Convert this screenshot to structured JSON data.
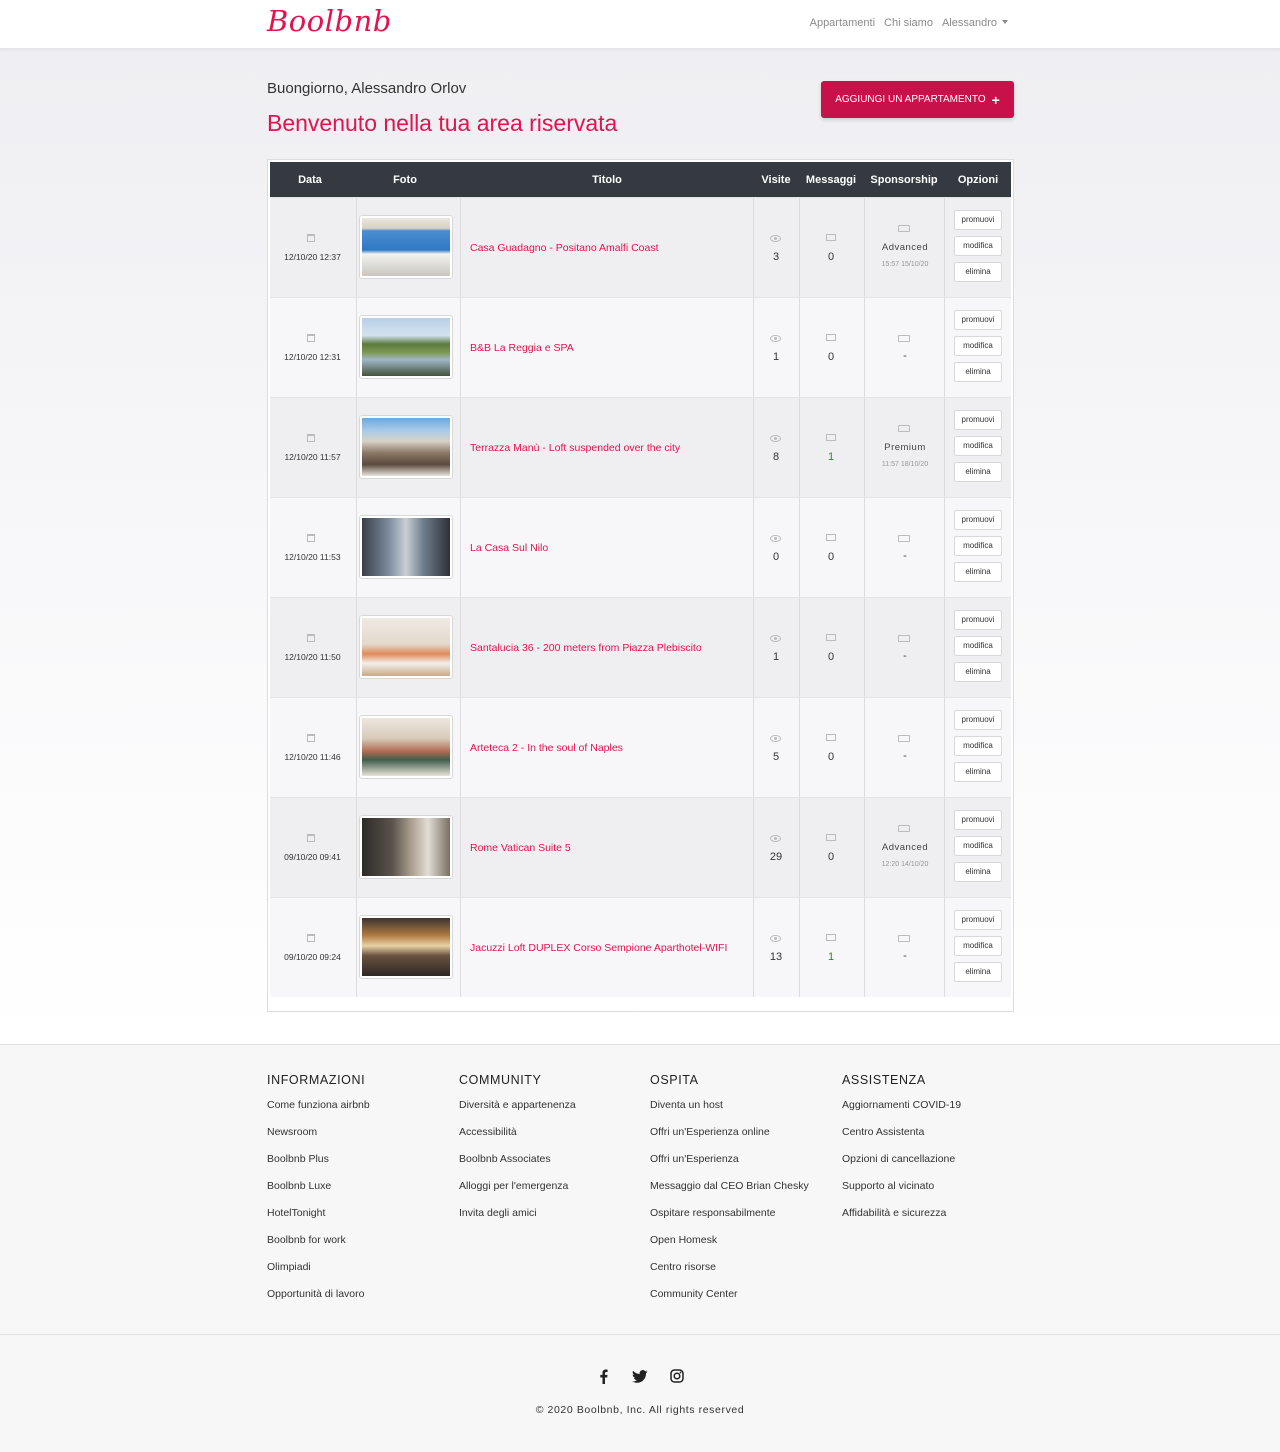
{
  "brand": "Boolbnb",
  "nav": {
    "apartments": "Appartamenti",
    "about": "Chi siamo",
    "user": "Alessandro"
  },
  "header": {
    "greeting": "Buongiorno, Alessandro Orlov",
    "welcome": "Benvenuto nella tua area riservata",
    "add_button": "AGGIUNGI UN APPARTAMENTO",
    "accent_color": "#e0144e"
  },
  "table": {
    "headers": {
      "date": "Data",
      "photo": "Foto",
      "title": "Titolo",
      "visits": "Visite",
      "messages": "Messaggi",
      "sponsorship": "Sponsorship",
      "options": "Opzioni"
    },
    "options": {
      "promote": "promuovi",
      "edit": "modifica",
      "delete": "elimina"
    },
    "rows": [
      {
        "date": "12/10/20 12:37",
        "title": "Casa Guadagno - Positano Amalfi Coast",
        "visits": "3",
        "messages": "0",
        "sponsor": "Advanced",
        "sponsor_time": "15:57 15/10/20"
      },
      {
        "date": "12/10/20 12:31",
        "title": "B&B La Reggia e SPA",
        "visits": "1",
        "messages": "0",
        "sponsor": "-",
        "sponsor_time": ""
      },
      {
        "date": "12/10/20 11:57",
        "title": "Terrazza Manù - Loft suspended over the city",
        "visits": "8",
        "messages": "1",
        "sponsor": "Premium",
        "sponsor_time": "11:57 18/10/20"
      },
      {
        "date": "12/10/20 11:53",
        "title": "La Casa Sul Nilo",
        "visits": "0",
        "messages": "0",
        "sponsor": "-",
        "sponsor_time": ""
      },
      {
        "date": "12/10/20 11:50",
        "title": "Santalucia 36 - 200 meters from Piazza Plebiscito",
        "visits": "1",
        "messages": "0",
        "sponsor": "-",
        "sponsor_time": ""
      },
      {
        "date": "12/10/20 11:46",
        "title": "Arteteca 2 - In the soul of Naples",
        "visits": "5",
        "messages": "0",
        "sponsor": "-",
        "sponsor_time": ""
      },
      {
        "date": "09/10/20 09:41",
        "title": "Rome Vatican Suite 5",
        "visits": "29",
        "messages": "0",
        "sponsor": "Advanced",
        "sponsor_time": "12:20 14/10/20"
      },
      {
        "date": "09/10/20 09:24",
        "title": "Jacuzzi Loft DUPLEX Corso Sempione Aparthotel-WIFI",
        "visits": "13",
        "messages": "1",
        "sponsor": "-",
        "sponsor_time": ""
      }
    ]
  },
  "footer": {
    "columns": [
      {
        "title": "INFORMAZIONI",
        "links": [
          "Come funziona airbnb",
          "Newsroom",
          "Boolbnb Plus",
          "Boolbnb Luxe",
          "HotelTonight",
          "Boolbnb for work",
          "Olimpiadi",
          "Opportunità di lavoro"
        ]
      },
      {
        "title": "COMMUNITY",
        "links": [
          "Diversità e appartenenza",
          "Accessibilità",
          "Boolbnb Associates",
          "Alloggi per l'emergenza",
          "Invita degli amici"
        ]
      },
      {
        "title": "OSPITA",
        "links": [
          "Diventa un host",
          "Offri un'Esperienza online",
          "Offri un'Esperienza",
          "Messaggio dal CEO Brian Chesky",
          "Ospitare responsabilmente",
          "Open Homesk",
          "Centro risorse",
          "Community Center"
        ]
      },
      {
        "title": "ASSISTENZA",
        "links": [
          "Aggiornamenti COVID-19",
          "Centro Assistenta",
          "Opzioni di cancellazione",
          "Supporto al vicinato",
          "Affidabilità e sicurezza"
        ]
      }
    ],
    "copyright": "© 2020 Boolbnb, Inc. All rights reserved"
  }
}
